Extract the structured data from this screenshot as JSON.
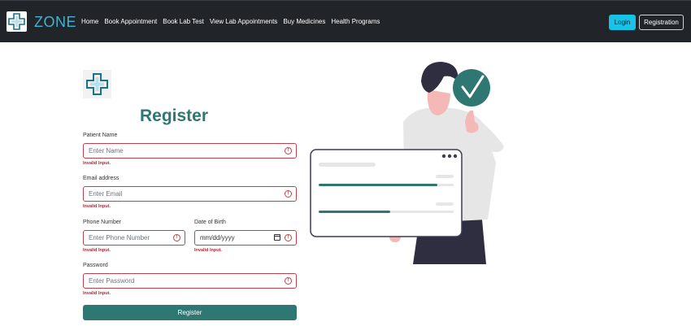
{
  "brand": {
    "name": "ZONE"
  },
  "nav": {
    "links": [
      "Home",
      "Book Appointment",
      "Book Lab Test",
      "View Lab Appointments",
      "Buy Medicines",
      "Health Programs"
    ],
    "login": "Login",
    "registration": "Registration"
  },
  "form": {
    "title": "Register",
    "fields": {
      "name": {
        "label": "Patient Name",
        "placeholder": "Enter Name",
        "error": "Invalid Input."
      },
      "email": {
        "label": "Email address",
        "placeholder": "Enter Email",
        "error": "Invalid Input."
      },
      "phone": {
        "label": "Phone Number",
        "placeholder": "Enter Phone Number",
        "error": "Invalid Input."
      },
      "dob": {
        "label": "Date of Birth",
        "placeholder": "mm/dd/yyyy",
        "error": "Invalid Input."
      },
      "password": {
        "label": "Password",
        "placeholder": "Enter Password",
        "error": "Invalid Input."
      }
    },
    "submit": "Register"
  },
  "icons": {
    "logo": "medical-cross-icon",
    "error": "exclamation-circle-icon",
    "calendar": "calendar-icon",
    "check": "check-icon",
    "menu": "more-dots-icon"
  },
  "colors": {
    "navbar": "#212529",
    "brand": "#3fb3cf",
    "primary": "#2e7772",
    "login": "#17c4e8",
    "error": "#c0414b"
  }
}
